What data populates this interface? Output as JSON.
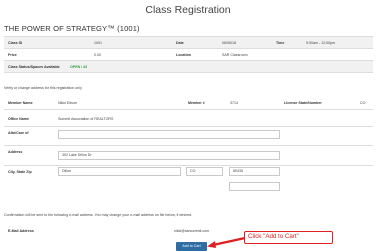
{
  "page_title": "Class Registration",
  "course_title": "THE POWER OF STRATEGY™ (1001)",
  "class_info": {
    "class_id_label": "Class ID",
    "class_id": "1001",
    "date_label": "Date",
    "date": "06/06/18",
    "time_label": "Time",
    "time": "9:00am - 12:00pm",
    "price_label": "Price",
    "price": "0.00",
    "location_label": "Location",
    "location": "SAR Classroom",
    "status_label": "Class Status/Spaces Available",
    "status": "OPEN / 43"
  },
  "verify_text": "Verify or change address for this registration only",
  "member": {
    "name_label": "Member Name",
    "name": "Nikki Edson",
    "number_label": "Member #",
    "number": "3714",
    "license_label": "License State/Number",
    "license_state": "CO",
    "office_label": "Office Name",
    "office": "Summit Association of REALTORS"
  },
  "address": {
    "attn_label": "Attn/Care of",
    "attn_value": "",
    "address_label": "Address",
    "address_value": "302 Lake Dillon Dr",
    "city_label": "City, State Zip",
    "city_value": "Dillon",
    "state_value": "CO",
    "zip_value": "80435",
    "extra_value": ""
  },
  "confirmation_text": "Confirmation will be sent to the following e-mail address. You may change your e-mail address on file below, if desired.",
  "email": {
    "label": "E-Mail Address",
    "value": "nikki@sarsummit.com"
  },
  "add_to_cart_label": "Add to Cart",
  "callout_text": "Click \"Add to Cart\"",
  "colors": {
    "button": "#2e6da4",
    "callout": "#e02020",
    "status": "#2e9e3e"
  }
}
